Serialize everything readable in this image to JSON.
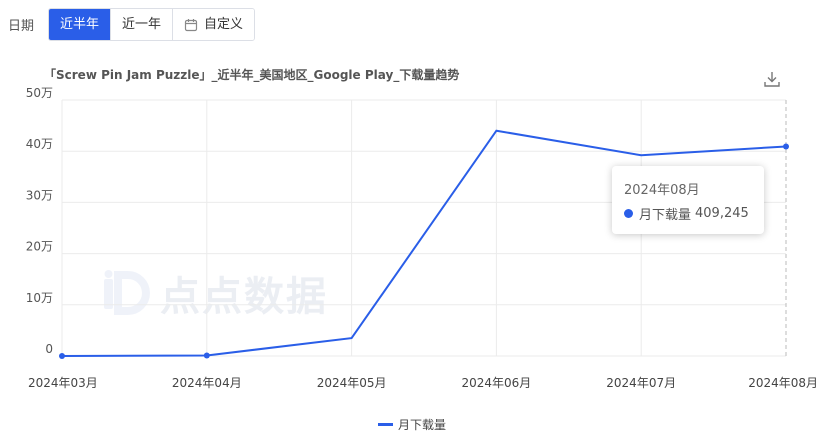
{
  "filters": {
    "label": "日期",
    "options": [
      {
        "label": "近半年",
        "active": true
      },
      {
        "label": "近一年",
        "active": false
      },
      {
        "label": "自定义",
        "active": false,
        "icon": "calendar-icon"
      }
    ]
  },
  "chart_title": "「Screw Pin Jam Puzzle」_近半年_美国地区_Google Play_下载量趋势",
  "download_icon": "download-icon",
  "watermark": "点点数据",
  "tooltip": {
    "title": "2024年08月",
    "series_name": "月下载量",
    "value": "409,245"
  },
  "legend": {
    "label": "月下载量",
    "color": "#2a5ee8"
  },
  "chart_data": {
    "type": "line",
    "title": "「Screw Pin Jam Puzzle」_近半年_美国地区_Google Play_下载量趋势",
    "xlabel": "",
    "ylabel": "",
    "categories": [
      "2024年03月",
      "2024年04月",
      "2024年05月",
      "2024年06月",
      "2024年07月",
      "2024年08月"
    ],
    "series": [
      {
        "name": "月下载量",
        "values": [
          0,
          1000,
          35000,
          440000,
          392000,
          409245
        ],
        "color": "#2a5ee8"
      }
    ],
    "ylim": [
      0,
      500000
    ],
    "yticks": [
      0,
      100000,
      200000,
      300000,
      400000,
      500000
    ],
    "ytick_labels": [
      "0",
      "10万",
      "20万",
      "30万",
      "40万",
      "50万"
    ],
    "grid": true,
    "legend_position": "bottom-center"
  }
}
